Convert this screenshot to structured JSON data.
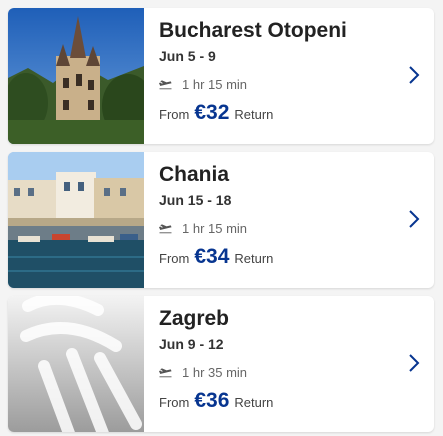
{
  "accent_color": "#073590",
  "chevron_color": "#073590",
  "flights": [
    {
      "destination": "Bucharest Otopeni",
      "dates": "Jun 5 - 9",
      "duration": "1 hr 15 min",
      "from_label": "From",
      "price": "€32",
      "trip_type": "Return",
      "image": "castle-photo"
    },
    {
      "destination": "Chania",
      "dates": "Jun 15 - 18",
      "duration": "1 hr 15 min",
      "from_label": "From",
      "price": "€34",
      "trip_type": "Return",
      "image": "harbour-photo"
    },
    {
      "destination": "Zagreb",
      "dates": "Jun 9 - 12",
      "duration": "1 hr 35 min",
      "from_label": "From",
      "price": "€36",
      "trip_type": "Return",
      "image": "placeholder-image"
    }
  ]
}
